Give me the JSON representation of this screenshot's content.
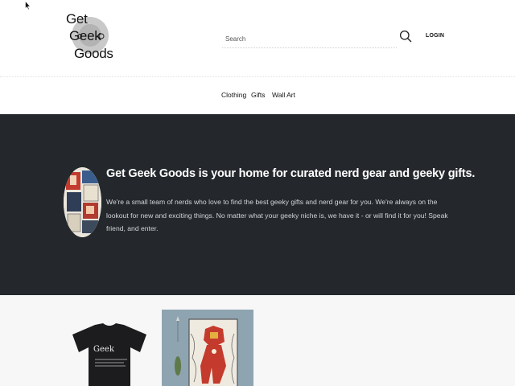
{
  "header": {
    "logo_lines": [
      "Get",
      "Geek",
      "Goods"
    ],
    "search_placeholder": "Search",
    "login_label": "LOGIN"
  },
  "nav": {
    "items": [
      {
        "label": "Clothing"
      },
      {
        "label": "Gifts"
      },
      {
        "label": "Wall Art"
      }
    ]
  },
  "hero": {
    "title": "Get Geek Goods is your home for curated nerd gear and geeky gifts.",
    "body": "We're a small team of nerds who love to find the best geeky gifts and nerd gear for you. We're always on the lookout for new and exciting things. No matter what your geeky niche is, we have it - or will find it for you! Speak friend, and enter."
  },
  "products": {
    "shirt_print": "Geek",
    "colors": {
      "hero_bg": "#24282c",
      "products_bg": "#f7f7f8",
      "shirt": "#1c1c1e"
    }
  }
}
